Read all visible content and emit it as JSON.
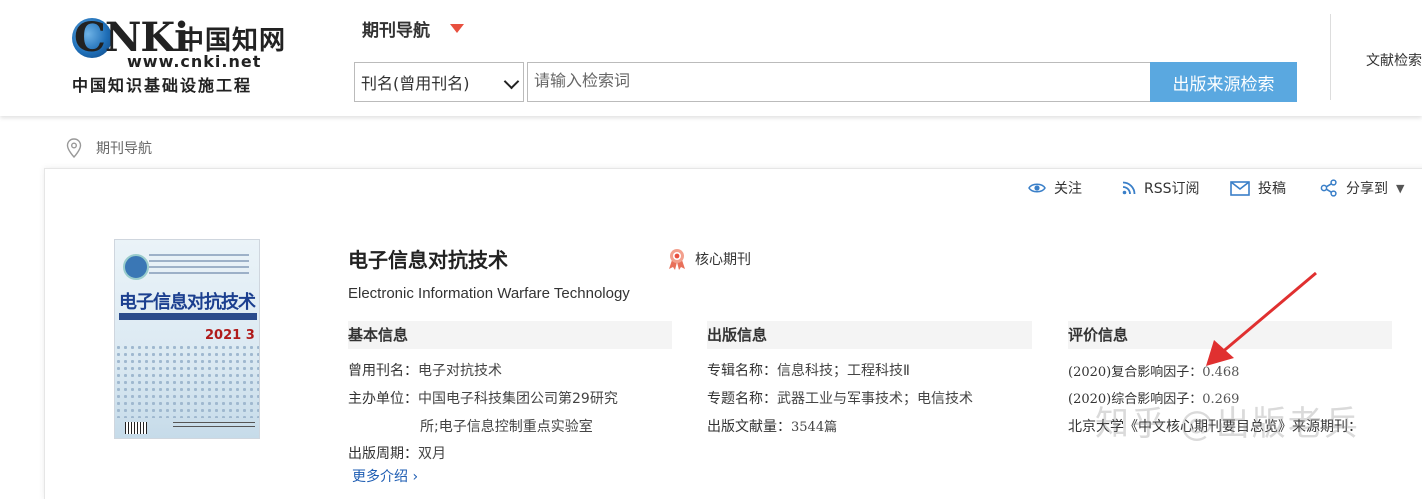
{
  "header": {
    "logo": {
      "brand": "CNKi",
      "brand_cn": "中国知网",
      "url": "www.cnki.net",
      "subtitle": "中国知识基础设施工程"
    },
    "nav_title": "期刊导航",
    "search": {
      "field_selected": "刊名(曾用刊名)",
      "placeholder": "请输入检索词",
      "button_label": "出版来源检索"
    },
    "doc_search_label": "文献检索"
  },
  "breadcrumb": {
    "label": "期刊导航"
  },
  "toolbar": {
    "follow": "关注",
    "rss": "RSS订阅",
    "submit": "投稿",
    "share": "分享到"
  },
  "journal": {
    "title": "电子信息对抗技术",
    "core_badge": "核心期刊",
    "english_title": "Electronic Information Warfare Technology",
    "cover": {
      "title": "电子信息对抗技术",
      "year": "2021 3"
    }
  },
  "basic_info": {
    "heading": "基本信息",
    "former_name_label": "曾用刊名：",
    "former_name": "电子对抗技术",
    "sponsor_label": "主办单位：",
    "sponsor_line1": "中国电子科技集团公司第29研究",
    "sponsor_line2": "所;电子信息控制重点实验室",
    "cycle_label": "出版周期：",
    "cycle": "双月",
    "more": "更多介绍 ›"
  },
  "publish_info": {
    "heading": "出版信息",
    "album_label": "专辑名称：",
    "album": "信息科技；工程科技Ⅱ",
    "topic_label": "专题名称：",
    "topic": "武器工业与军事技术；电信技术",
    "count_label": "出版文献量：",
    "count": "3544篇"
  },
  "eval_info": {
    "heading": "评价信息",
    "composite_label": "(2020)复合影响因子：",
    "composite": "0.468",
    "comprehensive_label": "(2020)综合影响因子：",
    "comprehensive": "0.269",
    "pku_label": "北京大学《中文核心期刊要目总览》来源期刊："
  },
  "watermark": "知乎 @出版老兵",
  "colors": {
    "search_button": "#5aa8e0",
    "accent_red": "#e8503f",
    "link_blue": "#1e5db3",
    "arrow_red": "#e03030"
  }
}
